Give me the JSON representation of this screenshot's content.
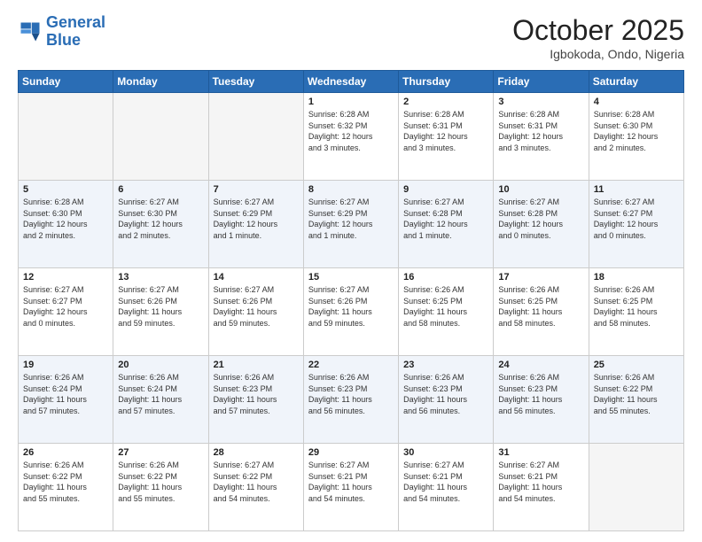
{
  "header": {
    "logo_line1": "General",
    "logo_line2": "Blue",
    "month": "October 2025",
    "location": "Igbokoda, Ondo, Nigeria"
  },
  "weekdays": [
    "Sunday",
    "Monday",
    "Tuesday",
    "Wednesday",
    "Thursday",
    "Friday",
    "Saturday"
  ],
  "weeks": [
    [
      {
        "day": "",
        "info": ""
      },
      {
        "day": "",
        "info": ""
      },
      {
        "day": "",
        "info": ""
      },
      {
        "day": "1",
        "info": "Sunrise: 6:28 AM\nSunset: 6:32 PM\nDaylight: 12 hours\nand 3 minutes."
      },
      {
        "day": "2",
        "info": "Sunrise: 6:28 AM\nSunset: 6:31 PM\nDaylight: 12 hours\nand 3 minutes."
      },
      {
        "day": "3",
        "info": "Sunrise: 6:28 AM\nSunset: 6:31 PM\nDaylight: 12 hours\nand 3 minutes."
      },
      {
        "day": "4",
        "info": "Sunrise: 6:28 AM\nSunset: 6:30 PM\nDaylight: 12 hours\nand 2 minutes."
      }
    ],
    [
      {
        "day": "5",
        "info": "Sunrise: 6:28 AM\nSunset: 6:30 PM\nDaylight: 12 hours\nand 2 minutes."
      },
      {
        "day": "6",
        "info": "Sunrise: 6:27 AM\nSunset: 6:30 PM\nDaylight: 12 hours\nand 2 minutes."
      },
      {
        "day": "7",
        "info": "Sunrise: 6:27 AM\nSunset: 6:29 PM\nDaylight: 12 hours\nand 1 minute."
      },
      {
        "day": "8",
        "info": "Sunrise: 6:27 AM\nSunset: 6:29 PM\nDaylight: 12 hours\nand 1 minute."
      },
      {
        "day": "9",
        "info": "Sunrise: 6:27 AM\nSunset: 6:28 PM\nDaylight: 12 hours\nand 1 minute."
      },
      {
        "day": "10",
        "info": "Sunrise: 6:27 AM\nSunset: 6:28 PM\nDaylight: 12 hours\nand 0 minutes."
      },
      {
        "day": "11",
        "info": "Sunrise: 6:27 AM\nSunset: 6:27 PM\nDaylight: 12 hours\nand 0 minutes."
      }
    ],
    [
      {
        "day": "12",
        "info": "Sunrise: 6:27 AM\nSunset: 6:27 PM\nDaylight: 12 hours\nand 0 minutes."
      },
      {
        "day": "13",
        "info": "Sunrise: 6:27 AM\nSunset: 6:26 PM\nDaylight: 11 hours\nand 59 minutes."
      },
      {
        "day": "14",
        "info": "Sunrise: 6:27 AM\nSunset: 6:26 PM\nDaylight: 11 hours\nand 59 minutes."
      },
      {
        "day": "15",
        "info": "Sunrise: 6:27 AM\nSunset: 6:26 PM\nDaylight: 11 hours\nand 59 minutes."
      },
      {
        "day": "16",
        "info": "Sunrise: 6:26 AM\nSunset: 6:25 PM\nDaylight: 11 hours\nand 58 minutes."
      },
      {
        "day": "17",
        "info": "Sunrise: 6:26 AM\nSunset: 6:25 PM\nDaylight: 11 hours\nand 58 minutes."
      },
      {
        "day": "18",
        "info": "Sunrise: 6:26 AM\nSunset: 6:25 PM\nDaylight: 11 hours\nand 58 minutes."
      }
    ],
    [
      {
        "day": "19",
        "info": "Sunrise: 6:26 AM\nSunset: 6:24 PM\nDaylight: 11 hours\nand 57 minutes."
      },
      {
        "day": "20",
        "info": "Sunrise: 6:26 AM\nSunset: 6:24 PM\nDaylight: 11 hours\nand 57 minutes."
      },
      {
        "day": "21",
        "info": "Sunrise: 6:26 AM\nSunset: 6:23 PM\nDaylight: 11 hours\nand 57 minutes."
      },
      {
        "day": "22",
        "info": "Sunrise: 6:26 AM\nSunset: 6:23 PM\nDaylight: 11 hours\nand 56 minutes."
      },
      {
        "day": "23",
        "info": "Sunrise: 6:26 AM\nSunset: 6:23 PM\nDaylight: 11 hours\nand 56 minutes."
      },
      {
        "day": "24",
        "info": "Sunrise: 6:26 AM\nSunset: 6:23 PM\nDaylight: 11 hours\nand 56 minutes."
      },
      {
        "day": "25",
        "info": "Sunrise: 6:26 AM\nSunset: 6:22 PM\nDaylight: 11 hours\nand 55 minutes."
      }
    ],
    [
      {
        "day": "26",
        "info": "Sunrise: 6:26 AM\nSunset: 6:22 PM\nDaylight: 11 hours\nand 55 minutes."
      },
      {
        "day": "27",
        "info": "Sunrise: 6:26 AM\nSunset: 6:22 PM\nDaylight: 11 hours\nand 55 minutes."
      },
      {
        "day": "28",
        "info": "Sunrise: 6:27 AM\nSunset: 6:22 PM\nDaylight: 11 hours\nand 54 minutes."
      },
      {
        "day": "29",
        "info": "Sunrise: 6:27 AM\nSunset: 6:21 PM\nDaylight: 11 hours\nand 54 minutes."
      },
      {
        "day": "30",
        "info": "Sunrise: 6:27 AM\nSunset: 6:21 PM\nDaylight: 11 hours\nand 54 minutes."
      },
      {
        "day": "31",
        "info": "Sunrise: 6:27 AM\nSunset: 6:21 PM\nDaylight: 11 hours\nand 54 minutes."
      },
      {
        "day": "",
        "info": ""
      }
    ]
  ]
}
